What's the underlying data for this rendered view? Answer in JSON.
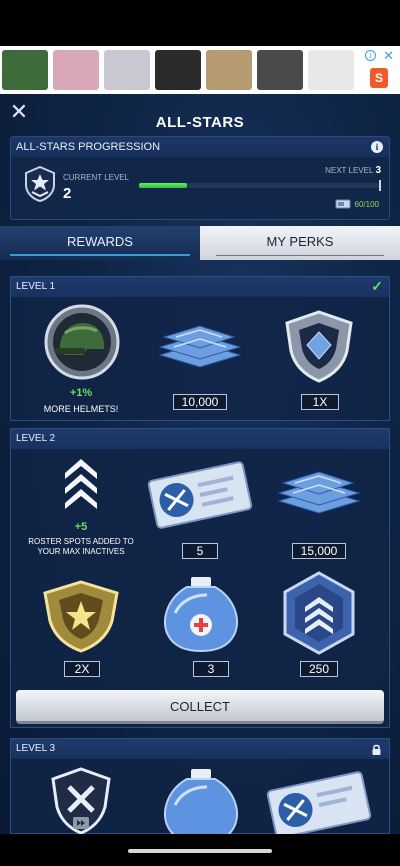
{
  "ad": {
    "thumb_colors": [
      "#3d6b3a",
      "#d8a7b8",
      "#c9c7d2",
      "#2b2b2b",
      "#b59a72",
      "#4a4a4a",
      "#e8e8e8",
      "#1f1f1f"
    ],
    "info_glyph": "i",
    "close_glyph": "✕",
    "shop_glyph": "S"
  },
  "header": {
    "title": "ALL-STARS",
    "close_glyph": "✕"
  },
  "progression": {
    "title": "ALL-STARS PROGRESSION",
    "info_glyph": "i",
    "current_level_label": "CURRENT LEVEL",
    "current_level": "2",
    "next_level_label": "NEXT LEVEL",
    "next_level": "3",
    "xp_text": "60/100",
    "progress_fraction": 0.2
  },
  "tabs": [
    {
      "label": "REWARDS",
      "active": true
    },
    {
      "label": "MY PERKS",
      "active": false
    }
  ],
  "levels": [
    {
      "title": "LEVEL 1",
      "status": "completed",
      "check_glyph": "✓",
      "perk": {
        "value": "+1%",
        "text": "MORE HELMETS!"
      },
      "rewards": [
        {
          "icon": "cash-stack-icon",
          "qty": "10,000"
        },
        {
          "icon": "silver-shield-icon",
          "qty": "1X"
        }
      ]
    },
    {
      "title": "LEVEL 2",
      "status": "collectable",
      "perk": {
        "value": "+5",
        "text": "ROSTER SPOTS ADDED TO YOUR MAX INACTIVES"
      },
      "rewards": [
        {
          "icon": "ticket-icon",
          "qty": "5"
        },
        {
          "icon": "cash-stack-icon",
          "qty": "15,000"
        },
        {
          "icon": "gold-shield-icon",
          "qty": "2X"
        },
        {
          "icon": "ice-pack-icon",
          "qty": "3"
        },
        {
          "icon": "rank-badge-icon",
          "qty": "250"
        }
      ],
      "collect_label": "COLLECT"
    },
    {
      "title": "LEVEL 3",
      "status": "locked"
    }
  ],
  "colors": {
    "accent_green": "#5fe06b",
    "tab_underline": "#3a9ad9",
    "panel_bg": "#12264a"
  }
}
